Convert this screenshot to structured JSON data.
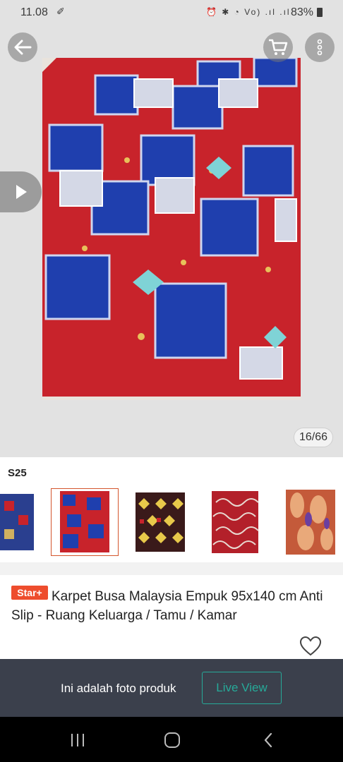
{
  "status_bar": {
    "time": "11.08",
    "battery": "83%",
    "icons": [
      "broom-icon",
      "alarm-icon",
      "bluetooth-icon",
      "wifi-icon",
      "volte-icon",
      "signal-icon",
      "battery-icon"
    ]
  },
  "top_bar": {
    "back_icon": "arrow-left-icon",
    "cart_icon": "cart-icon",
    "menu_icon": "more-vertical-icon"
  },
  "gallery": {
    "counter": "16/66",
    "play_icon": "play-icon",
    "image_description_icon": "carpet-photo"
  },
  "variants": {
    "label": "S25",
    "thumbnails": [
      {
        "name": "variant-blue-patchwork",
        "selected": false
      },
      {
        "name": "variant-red-patchwork",
        "selected": true
      },
      {
        "name": "variant-diamond-multicolor",
        "selected": false
      },
      {
        "name": "variant-red-lattice",
        "selected": false
      },
      {
        "name": "variant-feather-pattern",
        "selected": false
      }
    ]
  },
  "product": {
    "badge": "Star+",
    "title": "Karpet Busa Malaysia Empuk 95x140 cm Anti Slip - Ruang Keluarga / Tamu / Kamar",
    "favorite_icon": "heart-outline-icon"
  },
  "info_bar": {
    "text": "Ini adalah foto produk",
    "live_view_label": "Live View"
  },
  "nav_bar": {
    "recents_icon": "recents-icon",
    "home_icon": "home-icon",
    "back_icon": "back-icon"
  },
  "colors": {
    "accent": "#ee4d2d",
    "live_view": "#26aa99",
    "info_bar_bg": "#3b404c",
    "carpet_red": "#c8232b",
    "carpet_blue": "#1f3fae"
  }
}
